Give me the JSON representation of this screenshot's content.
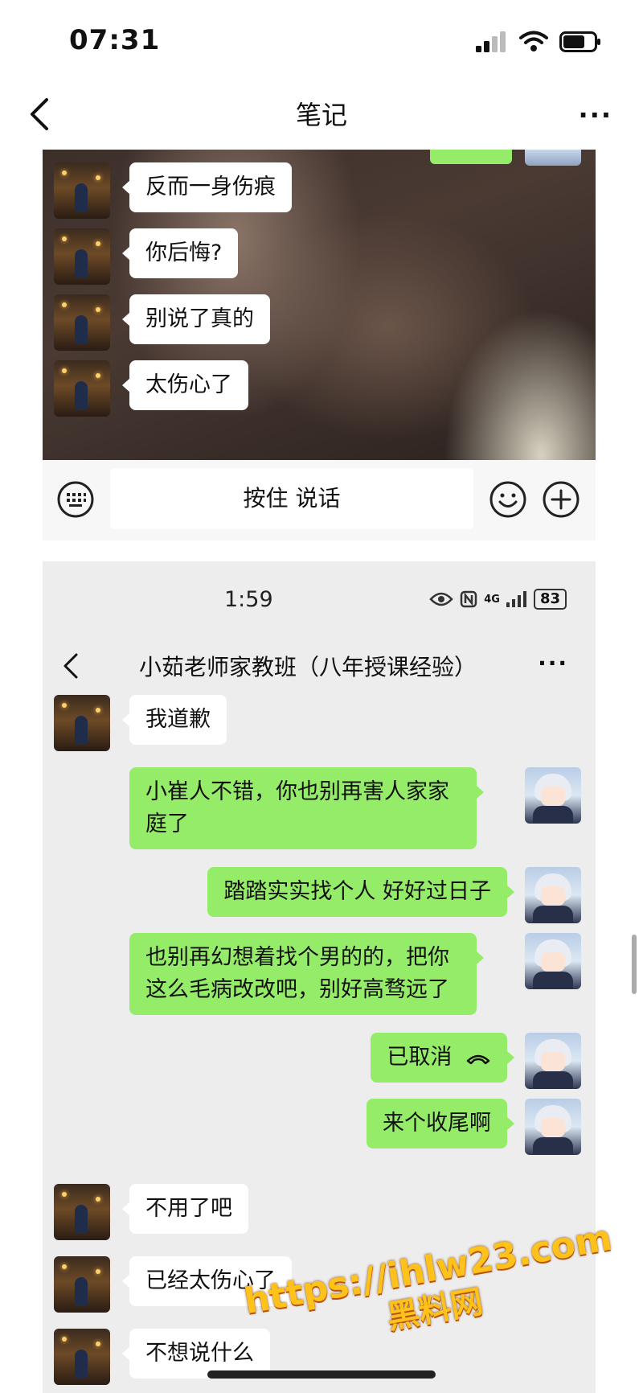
{
  "status_bar": {
    "time": "07:31"
  },
  "nav": {
    "title": "笔记",
    "more": "···"
  },
  "shot1": {
    "messages": [
      {
        "text": "反而一身伤痕"
      },
      {
        "text": "你后悔?"
      },
      {
        "text": "别说了真的"
      },
      {
        "text": "太伤心了"
      }
    ],
    "input_placeholder": "按住 说话"
  },
  "shot2": {
    "status_time": "1:59",
    "network": "4G",
    "battery": "83",
    "chat_title": "小茹老师家教班（八年授课经验）",
    "more": "···",
    "messages": [
      {
        "side": "left",
        "text": "我道歉"
      },
      {
        "side": "right",
        "text": "小崔人不错，你也别再害人家家庭了"
      },
      {
        "side": "right",
        "text": "踏踏实实找个人 好好过日子"
      },
      {
        "side": "right",
        "text": "也别再幻想着找个男的的，把你这么毛病改改吧，别好高骛远了"
      },
      {
        "side": "right",
        "text": "已取消"
      },
      {
        "side": "right",
        "text": "来个收尾啊"
      },
      {
        "side": "left",
        "text": "不用了吧"
      },
      {
        "side": "left",
        "text": "已经太伤心了"
      },
      {
        "side": "left",
        "text": "不想说什么"
      }
    ]
  },
  "watermark": {
    "url": "https://ihlw23.com",
    "name": "黑料网"
  },
  "colors": {
    "green_bubble": "#95ec69",
    "chat_bg": "#ededed",
    "watermark": "#ffc21a"
  }
}
